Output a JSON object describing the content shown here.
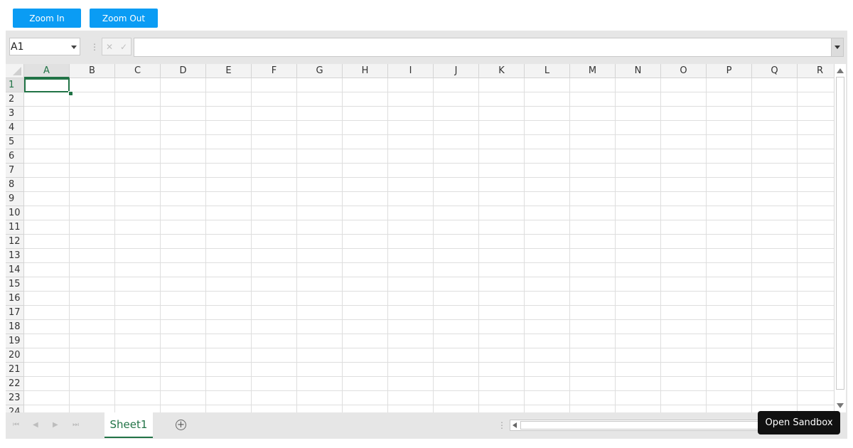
{
  "toolbar": {
    "zoom_in_label": "Zoom In",
    "zoom_out_label": "Zoom Out"
  },
  "formula_bar": {
    "name_box": "A1",
    "cancel_glyph": "✕",
    "confirm_glyph": "✓",
    "value": ""
  },
  "grid": {
    "columns": [
      "A",
      "B",
      "C",
      "D",
      "E",
      "F",
      "G",
      "H",
      "I",
      "J",
      "K",
      "L",
      "M",
      "N",
      "O",
      "P",
      "Q",
      "R"
    ],
    "rows": [
      "1",
      "2",
      "3",
      "4",
      "5",
      "6",
      "7",
      "8",
      "9",
      "10",
      "11",
      "12",
      "13",
      "14",
      "15",
      "16",
      "17",
      "18",
      "19",
      "20",
      "21",
      "22",
      "23",
      "24"
    ],
    "active_cell": "A1"
  },
  "sheets": {
    "tabs": [
      "Sheet1"
    ],
    "active": "Sheet1",
    "add_glyph": "+"
  },
  "sandbox_label": "Open Sandbox",
  "colors": {
    "accent": "#217346",
    "button": "#0a9cf4"
  }
}
